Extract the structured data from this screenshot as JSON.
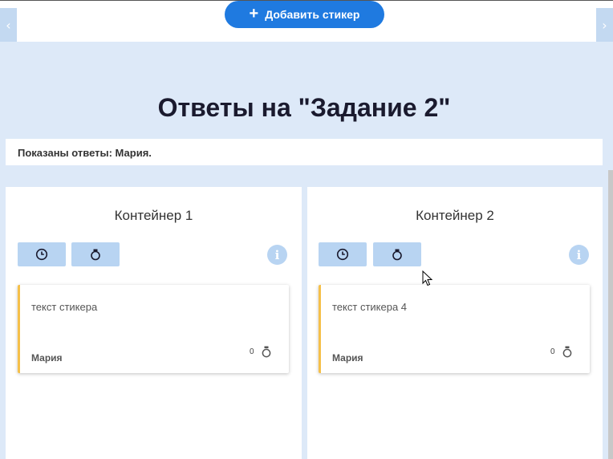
{
  "toolbar": {
    "add_sticker_label": "Добавить стикер"
  },
  "page": {
    "title": "Ответы на \"Задание 2\"",
    "filter_text": "Показаны ответы: Мария."
  },
  "containers": [
    {
      "title": "Контейнер 1",
      "sticker": {
        "text": "текст стикера",
        "author": "Мария",
        "likes": "0"
      }
    },
    {
      "title": "Контейнер 2",
      "sticker": {
        "text": "текст стикера 4",
        "author": "Мария",
        "likes": "0"
      }
    }
  ],
  "icons": {
    "add": "plus-icon",
    "sort_time": "clock-icon",
    "sort_likes": "bomb-icon",
    "info": "info-icon",
    "nav_left": "chevron-left-icon",
    "nav_right": "chevron-right-icon"
  },
  "colors": {
    "accent": "#1f7ae0",
    "background": "#dde9f8",
    "button_light": "#b8d4f2",
    "sticker_border": "#f5c04a"
  }
}
